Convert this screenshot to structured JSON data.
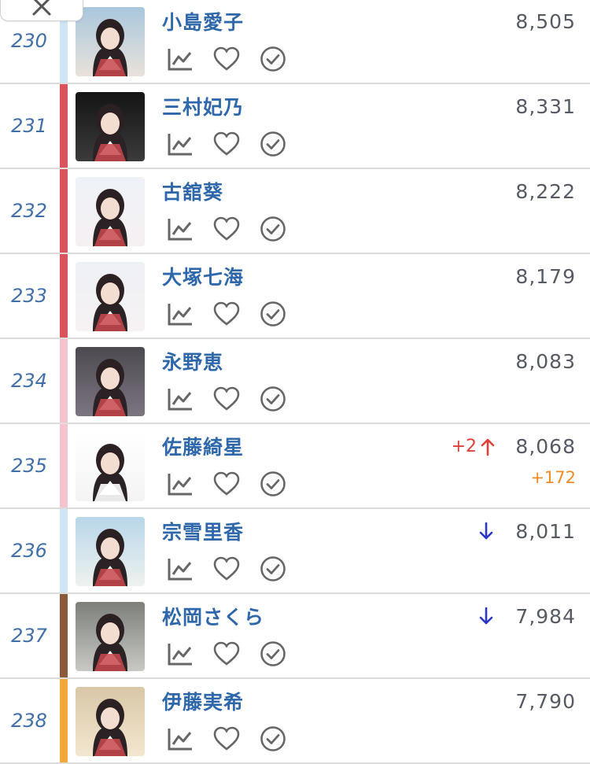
{
  "close": {
    "icon": "close-icon"
  },
  "colors": {
    "rank": "#3f6ea8",
    "name": "#2f68aa",
    "score": "#555a63",
    "up": "#e0403a",
    "down": "#2a36c8",
    "gain": "#f08a24"
  },
  "rows": [
    {
      "rank": "230",
      "name": "小島愛子",
      "score": "8,505",
      "delta": "",
      "trend": "",
      "gain": "",
      "bar": "#cfe4f5"
    },
    {
      "rank": "231",
      "name": "三村妃乃",
      "score": "8,331",
      "delta": "",
      "trend": "",
      "gain": "",
      "bar": "#db525a"
    },
    {
      "rank": "232",
      "name": "古舘葵",
      "score": "8,222",
      "delta": "",
      "trend": "",
      "gain": "",
      "bar": "#db525a"
    },
    {
      "rank": "233",
      "name": "大塚七海",
      "score": "8,179",
      "delta": "",
      "trend": "",
      "gain": "",
      "bar": "#db525a"
    },
    {
      "rank": "234",
      "name": "永野恵",
      "score": "8,083",
      "delta": "",
      "trend": "",
      "gain": "",
      "bar": "#f4c3cd"
    },
    {
      "rank": "235",
      "name": "佐藤綺星",
      "score": "8,068",
      "delta": "+2",
      "trend": "up",
      "gain": "+172",
      "bar": "#f4c3cd"
    },
    {
      "rank": "236",
      "name": "宗雪里香",
      "score": "8,011",
      "delta": "",
      "trend": "down",
      "gain": "",
      "bar": "#cfe4f5"
    },
    {
      "rank": "237",
      "name": "松岡さくら",
      "score": "7,984",
      "delta": "",
      "trend": "down",
      "gain": "",
      "bar": "#8a5a3a"
    },
    {
      "rank": "238",
      "name": "伊藤実希",
      "score": "7,790",
      "delta": "",
      "trend": "",
      "gain": "",
      "bar": "#f0a93a"
    }
  ]
}
